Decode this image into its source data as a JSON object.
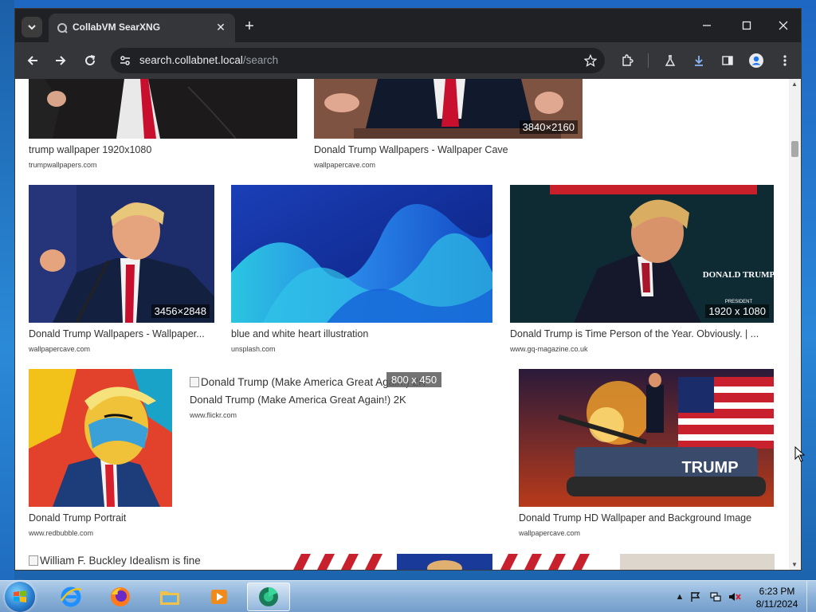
{
  "browser": {
    "tab_title": "CollabVM SearXNG",
    "url_host": "search.collabnet.local",
    "url_path": "/search"
  },
  "results": [
    {
      "title": "trump wallpaper 1920x1080",
      "source": "trumpwallpapers.com",
      "resolution": ""
    },
    {
      "title": "Donald Trump Wallpapers - Wallpaper Cave",
      "source": "wallpapercave.com",
      "resolution": "3840×2160"
    },
    {
      "title": "Donald Trump Wallpapers - Wallpaper...",
      "source": "wallpapercave.com",
      "resolution": "3456×2848"
    },
    {
      "title": "blue and white heart illustration",
      "source": "unsplash.com",
      "resolution": ""
    },
    {
      "title": "Donald Trump is Time Person of the Year. Obviously. | ...",
      "source": "www.gq-magazine.co.uk",
      "resolution": "1920 x 1080"
    },
    {
      "title": "Donald Trump Portrait",
      "source": "www.redbubble.com",
      "resolution": ""
    },
    {
      "title": "Donald Trump (Make America Great Again!) 2K",
      "source": "www.flickr.com",
      "alt": "Donald Trump (Make America Great Again!) 2K",
      "resolution": ""
    },
    {
      "title": "Donald Trump HD Wallpaper and Background Image",
      "source": "wallpapercave.com",
      "resolution": ""
    },
    {
      "alt": "William F. Buckley Idealism is fine"
    }
  ],
  "tooltip": "800 x 450",
  "time_magazine": {
    "cover_name": "DONALD TRUMP",
    "cover_sub": "PRESIDENT"
  },
  "tank_text": "TRUMP",
  "taskbar": {
    "time": "6:23 PM",
    "date": "8/11/2024"
  },
  "colors": {
    "browser_frame": "#202124",
    "toolbar": "#35363a",
    "page_bg": "#ffffff"
  }
}
